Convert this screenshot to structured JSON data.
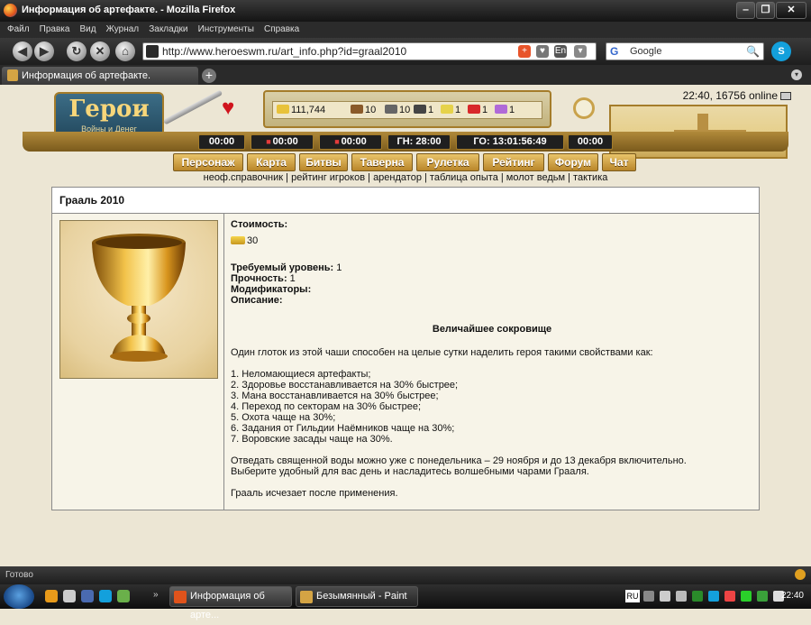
{
  "window": {
    "title": "Информация об артефакте. - Mozilla Firefox",
    "minimize": "‒",
    "maximize": "❐",
    "close": "✕"
  },
  "menubar": [
    "Файл",
    "Правка",
    "Вид",
    "Журнал",
    "Закладки",
    "Инструменты",
    "Справка"
  ],
  "navbar": {
    "url": "http://www.heroeswm.ru/art_info.php?id=graal2010",
    "search_placeholder": "Google",
    "icons": [
      "back-icon",
      "forward-icon",
      "reload-icon",
      "stop-icon",
      "home-icon"
    ]
  },
  "tab": {
    "label": "Информация об артефакте.",
    "new_tab": "+"
  },
  "game": {
    "logo_title": "Герои",
    "logo_subtitle": "Войны и Денег",
    "server_time": "22:40, 16756 online",
    "resources": {
      "gold": "111,744",
      "wood": "10",
      "ore": "10",
      "mercury": "1",
      "sulfur": "1",
      "crystals": "1",
      "gems": "1"
    },
    "timers": [
      "00:00",
      "00:00",
      "00:00",
      "ГН: 28:00",
      "ГО: 13:01:56:49",
      "00:00"
    ],
    "menu": [
      "Персонаж",
      "Карта",
      "Битвы",
      "Таверна",
      "Рулетка",
      "Рейтинг",
      "Форум",
      "Чат"
    ],
    "subnav": [
      "неоф.справочник",
      "рейтинг игроков",
      "арендатор",
      "таблица опыта",
      "молот ведьм",
      "тактика"
    ]
  },
  "artifact": {
    "title": "Грааль 2010",
    "cost_label": "Стоимость:",
    "cost_value": "30",
    "level_label": "Требуемый уровень:",
    "level_value": "1",
    "durability_label": "Прочность:",
    "durability_value": "1",
    "modifiers_label": "Модификаторы:",
    "description_label": "Описание:",
    "description_title": "Величайшее сокровище",
    "intro": "Один глоток из этой чаши способен на целые сутки наделить героя такими свойствами как:",
    "list": [
      "1. Неломающиеся артефакты;",
      "2. Здоровье восстанавливается на 30% быстрее;",
      "3. Мана восстанавливается на 30% быстрее;",
      "4. Переход по секторам на 30% быстрее;",
      "5. Охота чаще на 30%;",
      "6. Задания от Гильдии Наёмников чаще на 30%;",
      "7. Воровские засады чаще на 30%."
    ],
    "para1": "Отведать священной воды можно уже с понедельника – 29 ноября и до 13 декабря включительно.",
    "para2": "Выберите удобный для вас день и насладитесь волшебными чарами Грааля.",
    "para3": "Грааль исчезает после применения."
  },
  "statusbar": {
    "text": "Готово"
  },
  "taskbar": {
    "buttons": [
      "Информация об арте...",
      "Безымянный - Paint"
    ],
    "lang": "RU",
    "clock": "22:40"
  }
}
